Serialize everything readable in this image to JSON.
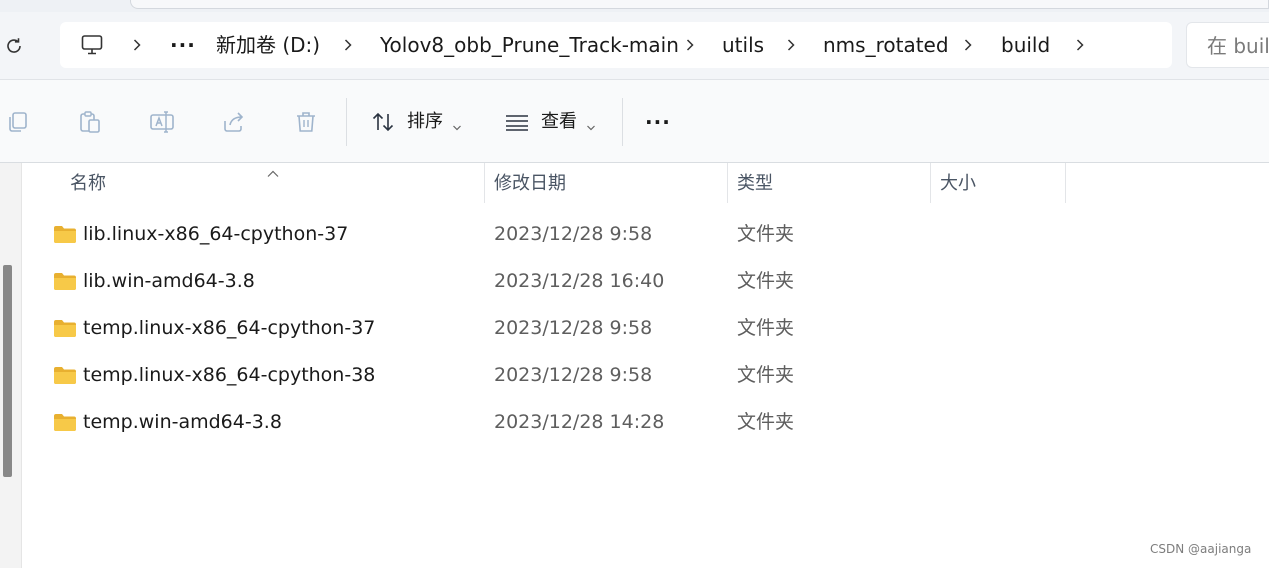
{
  "address": {
    "overflow_label": "···",
    "breadcrumbs": [
      "新加卷 (D:)",
      "Yolov8_obb_Prune_Track-main",
      "utils",
      "nms_rotated",
      "build"
    ],
    "search_placeholder": "在 buil"
  },
  "toolbar": {
    "sort_label": "排序",
    "view_label": "查看",
    "more_label": "···"
  },
  "columns": {
    "name": "名称",
    "date": "修改日期",
    "type": "类型",
    "size": "大小"
  },
  "rows": [
    {
      "name": "lib.linux-x86_64-cpython-37",
      "date": "2023/12/28 9:58",
      "type": "文件夹"
    },
    {
      "name": "lib.win-amd64-3.8",
      "date": "2023/12/28 16:40",
      "type": "文件夹"
    },
    {
      "name": "temp.linux-x86_64-cpython-37",
      "date": "2023/12/28 9:58",
      "type": "文件夹"
    },
    {
      "name": "temp.linux-x86_64-cpython-38",
      "date": "2023/12/28 9:58",
      "type": "文件夹"
    },
    {
      "name": "temp.win-amd64-3.8",
      "date": "2023/12/28 14:28",
      "type": "文件夹"
    }
  ],
  "watermark": "CSDN @aajianga",
  "colors": {
    "folder": "#f7c948",
    "folder_dark": "#e8b030",
    "accent": "#2b6fd6"
  }
}
